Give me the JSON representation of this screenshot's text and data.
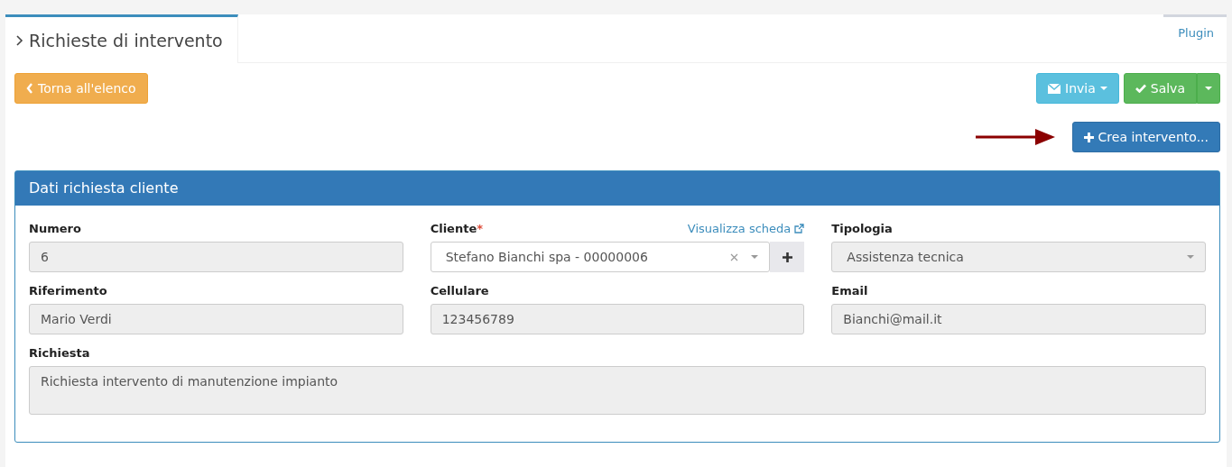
{
  "tabs": [
    {
      "label": "Richieste di intervento",
      "selected": true
    },
    {
      "label": "Plugin",
      "selected": false
    }
  ],
  "toolbar": {
    "back_button": "Torna all'elenco",
    "send_button": "Invia",
    "save_button": "Salva",
    "create_button": "Crea intervento..."
  },
  "panel": {
    "title": "Dati richiesta cliente",
    "fields": [
      {
        "kind": "text",
        "label": "Numero",
        "value": "6"
      },
      {
        "kind": "select",
        "label": "Cliente",
        "required_mark": "*",
        "link": "Visualizza scheda",
        "value": "Stefano Bianchi spa - 00000006"
      },
      {
        "kind": "dropdown",
        "label": "Tipologia",
        "value": "Assistenza tecnica"
      },
      {
        "kind": "text",
        "label": "Riferimento",
        "value": "Mario Verdi"
      },
      {
        "kind": "text",
        "label": "Cellulare",
        "value": "123456789"
      },
      {
        "kind": "text",
        "label": "Email",
        "value": "Bianchi@mail.it"
      },
      {
        "kind": "textarea",
        "label": "Richiesta",
        "value": "Richiesta intervento di manutenzione impianto"
      }
    ]
  }
}
